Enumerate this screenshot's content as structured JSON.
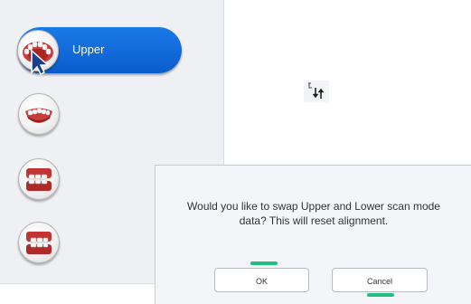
{
  "sidebar": {
    "mode_button": {
      "label": "Upper"
    },
    "buttons": [
      {
        "icon": "upper-arch-icon"
      },
      {
        "icon": "lower-arch-icon"
      },
      {
        "icon": "bite-left-icon"
      },
      {
        "icon": "bite-right-icon"
      }
    ]
  },
  "toolbar": {
    "swap_icon": "swap-upper-lower-icon"
  },
  "dialog": {
    "message_line1": "Would you like to swap Upper and Lower scan mode",
    "message_line2": "data?  This will reset alignment.",
    "ok_label": "OK",
    "cancel_label": "Cancel"
  },
  "colors": {
    "accent": "#0a66d6",
    "sidebar_bg": "#eef0f4",
    "dialog_bg": "#f4f5f8",
    "highlight": "#1fbf7f"
  }
}
